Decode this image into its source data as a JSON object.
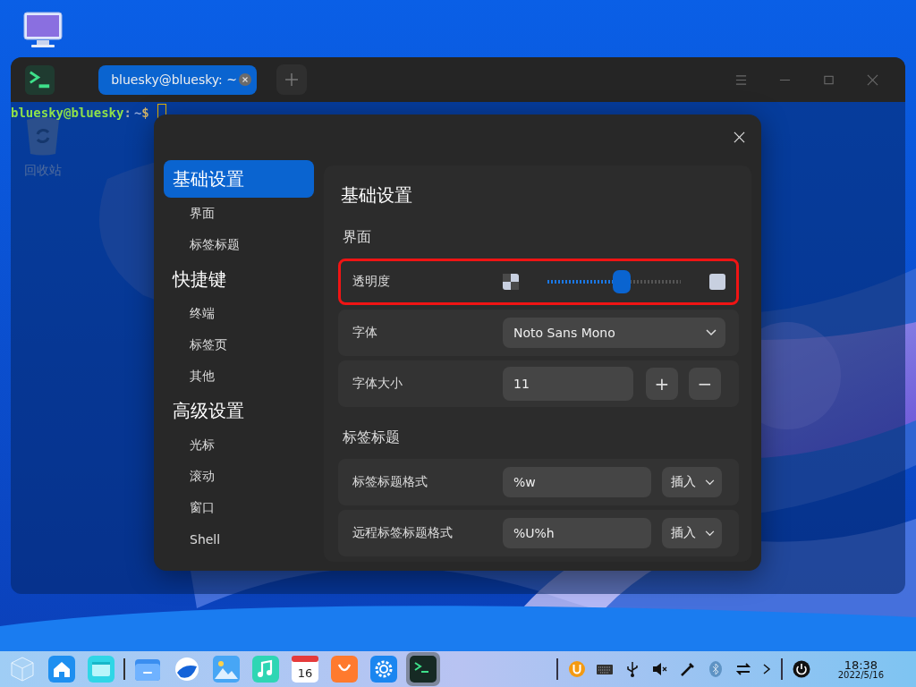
{
  "desktop_icons": [
    {
      "kind": "computer"
    },
    {
      "kind": "trash",
      "label": "回收站"
    }
  ],
  "terminal": {
    "tabs": [
      {
        "label": "bluesky@bluesky: ~",
        "selected": true
      }
    ],
    "prompt": {
      "user": "bluesky@bluesky",
      "separator": ":",
      "path": "~",
      "symbol": "$"
    }
  },
  "settings_dialog": {
    "sidebar": [
      {
        "label": "基础设置",
        "selected": true,
        "children": [
          {
            "label": "界面",
            "selected": false
          },
          {
            "label": "标签标题",
            "selected": false
          }
        ]
      },
      {
        "label": "快捷键",
        "selected": false,
        "children": [
          {
            "label": "终端",
            "selected": false
          },
          {
            "label": "标签页",
            "selected": false
          },
          {
            "label": "其他",
            "selected": false
          }
        ]
      },
      {
        "label": "高级设置",
        "selected": false,
        "children": [
          {
            "label": "光标",
            "selected": false
          },
          {
            "label": "滚动",
            "selected": false
          },
          {
            "label": "窗口",
            "selected": false
          },
          {
            "label": "Shell",
            "selected": false
          }
        ]
      }
    ],
    "title": "基础设置",
    "sections": [
      {
        "title": "界面",
        "rows": [
          {
            "kind": "slider",
            "label": "透明度",
            "level": 0.56,
            "highlighted": true
          },
          {
            "kind": "dropdown",
            "label": "字体",
            "value": "Noto Sans Mono",
            "highlighted": false
          },
          {
            "kind": "spinner",
            "label": "字体大小",
            "value": "11",
            "buttons": [
              "+",
              "−"
            ],
            "highlighted": false
          }
        ]
      },
      {
        "title": "标签标题",
        "rows": [
          {
            "kind": "field_menu",
            "label": "标签标题格式",
            "value": "%w",
            "menu": "插入",
            "highlighted": false
          },
          {
            "kind": "field_menu",
            "label": "远程标签标题格式",
            "value": "%U%h",
            "menu": "插入",
            "highlighted": false
          }
        ]
      }
    ]
  },
  "dock": [
    {
      "kind": "launcher",
      "active": false
    },
    {
      "kind": "home",
      "active": false
    },
    {
      "kind": "multitask",
      "active": false
    },
    {
      "kind": "divider"
    },
    {
      "kind": "files",
      "active": false
    },
    {
      "kind": "browser",
      "active": false
    },
    {
      "kind": "photos",
      "active": false
    },
    {
      "kind": "music",
      "active": false
    },
    {
      "kind": "calendar",
      "label": "16",
      "active": false
    },
    {
      "kind": "store",
      "active": false
    },
    {
      "kind": "settings",
      "active": false
    },
    {
      "kind": "terminal",
      "active": true
    }
  ],
  "tray": [
    {
      "kind": "divider"
    },
    {
      "kind": "input"
    },
    {
      "kind": "keyboard"
    },
    {
      "kind": "usb"
    },
    {
      "kind": "mute"
    },
    {
      "kind": "pen"
    },
    {
      "kind": "bluetooth"
    },
    {
      "kind": "switch"
    },
    {
      "kind": "chevron"
    },
    {
      "kind": "divider"
    },
    {
      "kind": "power"
    }
  ],
  "clock": {
    "time": "18:38",
    "date": "2022/5/16"
  }
}
